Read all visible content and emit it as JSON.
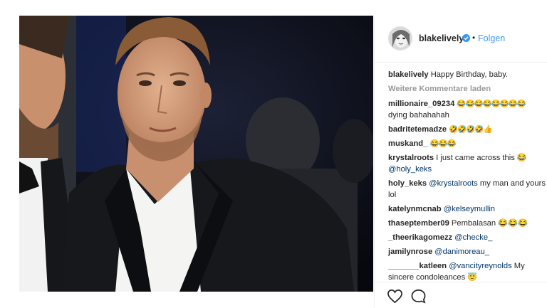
{
  "post": {
    "image_alt": "Photo of a man in a black tuxedo jacket and white shirt at an event",
    "author": "blakelively",
    "follow_label": "Folgen",
    "separator": "•",
    "load_more_label": "Weitere Kommentare laden"
  },
  "comments": [
    {
      "user": "blakelively",
      "text": "Happy Birthday, baby."
    },
    {
      "user": "millionaire_09234",
      "text": "😂😂😂😂😂😂😂😂",
      "text2": "dying bahahahah"
    },
    {
      "user": "badritetemadze",
      "text": "🤣🤣🤣🤣👍"
    },
    {
      "user": "muskand_",
      "text": "😂😂😂"
    },
    {
      "user": "krystalroots",
      "text": "I just came across this 😂",
      "mention": "@holy_keks"
    },
    {
      "user": "holy_keks",
      "mention": "@krystalroots",
      "text": "my man and yours",
      "text2": "lol"
    },
    {
      "user": "katelynmcnab",
      "mention": "@kelseymullin"
    },
    {
      "user": "thaseptember09",
      "text": "Pembalasan 😂😂😂"
    },
    {
      "user": "_theerikagomezz",
      "mention": "@checke_"
    },
    {
      "user": "jamilynrose",
      "mention": "@danimoreau_"
    },
    {
      "user": "_______katleen",
      "mention": "@vancityreynolds",
      "text": "My",
      "text2": "sincere condoleances 😇"
    }
  ],
  "actions": {
    "like_icon": "heart-icon",
    "comment_icon": "comment-icon"
  }
}
